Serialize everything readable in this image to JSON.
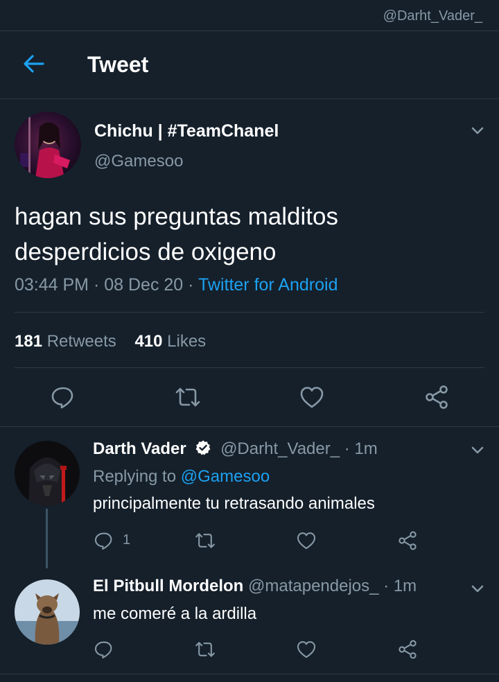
{
  "status_bar": {
    "account_watermark": "@Darht_Vader_"
  },
  "header": {
    "title": "Tweet",
    "back_icon": "arrow-left-icon"
  },
  "main_tweet": {
    "author_name": "Chichu | #TeamChanel",
    "author_handle": "@Gamesoo",
    "text_line1": "hagan sus preguntas malditos",
    "text_line2": "desperdicios de oxigeno",
    "time": "03:44 PM",
    "date": "08 Dec 20",
    "source": "Twitter for Android",
    "retweets_count": "181",
    "retweets_label": "Retweets",
    "likes_count": "410",
    "likes_label": "Likes"
  },
  "replies": [
    {
      "author_name": "Darth Vader",
      "verified": true,
      "author_handle": "@Darht_Vader_",
      "time": "· 1m",
      "replying_label": "Replying to",
      "replying_to": "@Gamesoo",
      "text": "principalmente tu retrasando animales",
      "reply_count": "1"
    },
    {
      "author_name": "El Pitbull Mordelon",
      "verified": false,
      "author_handle": "@matapendejos_",
      "time": "· 1m",
      "text": "me comeré a la ardilla"
    }
  ],
  "icons": [
    "arrow-left-icon",
    "chevron-down-icon",
    "reply-icon",
    "retweet-icon",
    "like-icon",
    "share-icon",
    "verified-badge-icon"
  ],
  "colors": {
    "background": "#15202b",
    "accent": "#1da1f2",
    "muted": "#8899a6",
    "divider": "#2f3a45"
  }
}
